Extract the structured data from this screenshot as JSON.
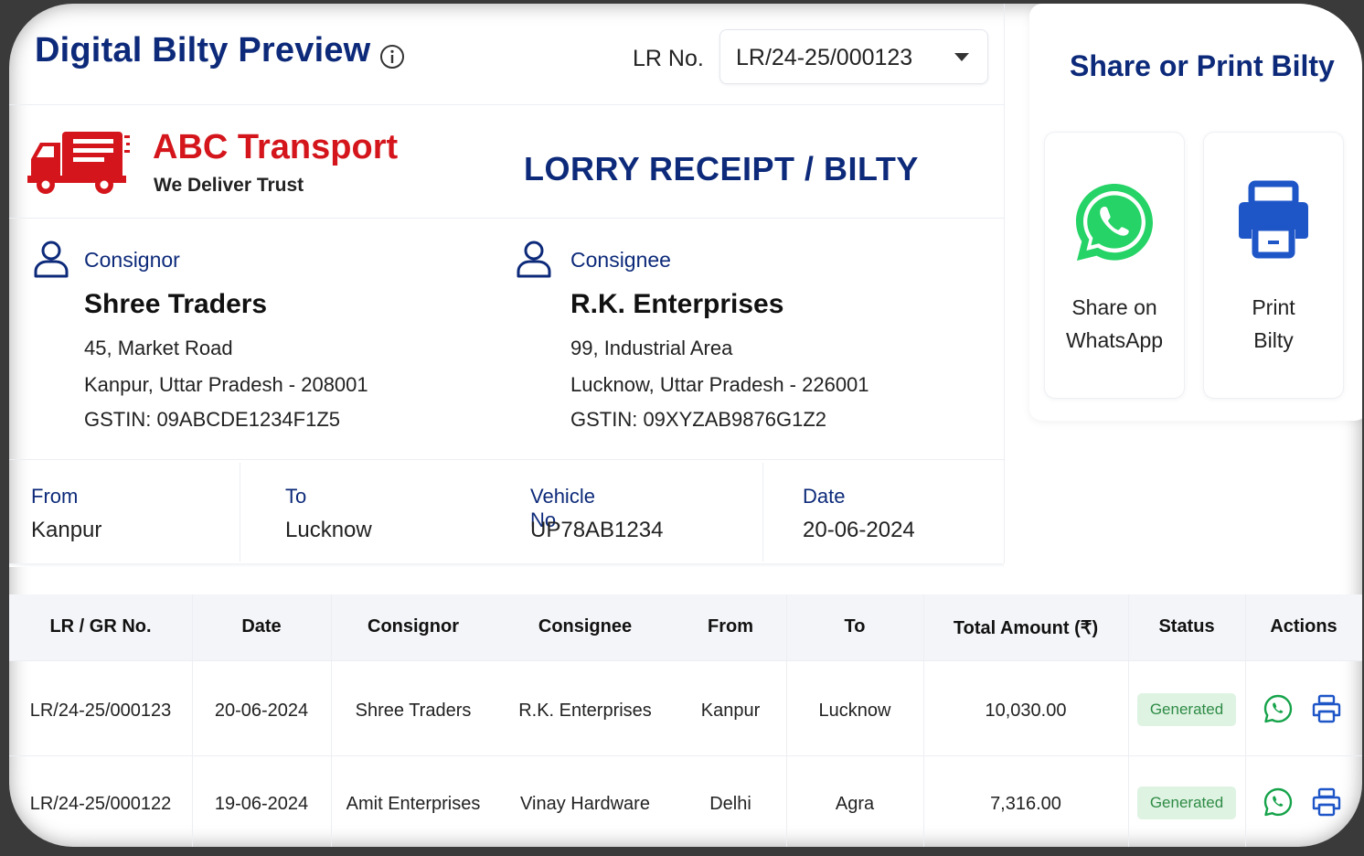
{
  "header": {
    "title": "Digital Bilty Preview",
    "lr_label": "LR No.",
    "lr_selected": "LR/24-25/000123"
  },
  "brand": {
    "name": "ABC Transport",
    "tagline": "We Deliver Trust",
    "document_title": "LORRY RECEIPT / BILTY",
    "accent_color": "#d4161c",
    "navy_color": "#0d2a7a"
  },
  "consignor": {
    "label": "Consignor",
    "name": "Shree Traders",
    "address1": "45, Market Road",
    "address2": "Kanpur, Uttar Pradesh - 208001",
    "gstin": "GSTIN: 09ABCDE1234F1Z5"
  },
  "consignee": {
    "label": "Consignee",
    "name": "R.K. Enterprises",
    "address1": "99, Industrial Area",
    "address2": "Lucknow, Uttar Pradesh - 226001",
    "gstin": "GSTIN: 09XYZAB9876G1Z2"
  },
  "trip": {
    "from_label": "From",
    "from_value": "Kanpur",
    "to_label": "To",
    "to_value": "Lucknow",
    "vehicle_label": "Vehicle No.",
    "vehicle_value": "UP78AB1234",
    "date_label": "Date",
    "date_value": "20-06-2024"
  },
  "share": {
    "title": "Share or Print Bilty",
    "whatsapp_line1": "Share on",
    "whatsapp_line2": "WhatsApp",
    "print_line1": "Print",
    "print_line2": "Bilty",
    "whatsapp_color": "#25d366",
    "print_color": "#1e56c8"
  },
  "table": {
    "headers": [
      "LR / GR No.",
      "Date",
      "Consignor",
      "Consignee",
      "From",
      "To",
      "Total Amount (₹)",
      "Status",
      "Actions"
    ],
    "rows": [
      {
        "lr": "LR/24-25/000123",
        "date": "20-06-2024",
        "consignor": "Shree Traders",
        "consignee": "R.K. Enterprises",
        "from": "Kanpur",
        "to": "Lucknow",
        "amount": "10,030.00",
        "status": "Generated"
      },
      {
        "lr": "LR/24-25/000122",
        "date": "19-06-2024",
        "consignor": "Amit Enterprises",
        "consignee": "Vinay Hardware",
        "from": "Delhi",
        "to": "Agra",
        "amount": "7,316.00",
        "status": "Generated"
      }
    ]
  }
}
